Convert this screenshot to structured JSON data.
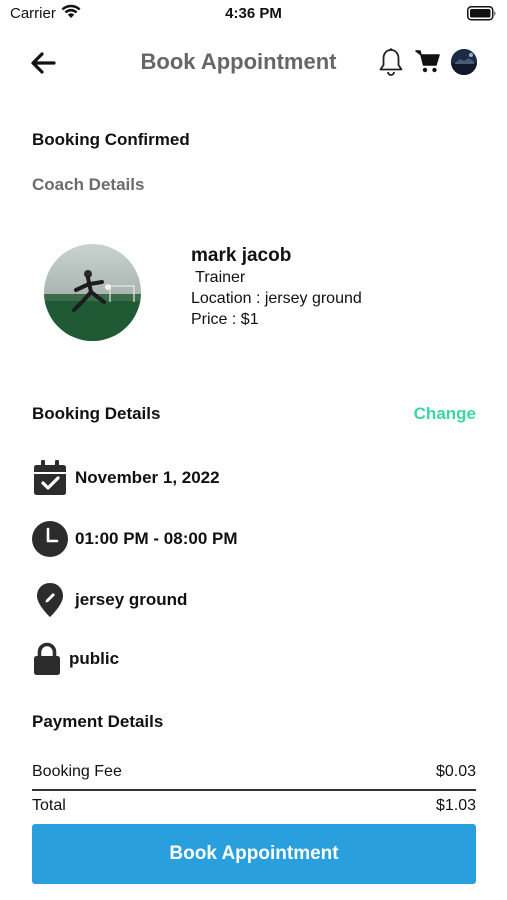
{
  "status_bar": {
    "carrier": "Carrier",
    "time": "4:36 PM"
  },
  "header": {
    "title": "Book Appointment",
    "icons": [
      "back-arrow-icon",
      "bell-icon",
      "cart-icon",
      "profile-avatar"
    ]
  },
  "booking": {
    "status": "Booking Confirmed"
  },
  "coach": {
    "section_title": "Coach Details",
    "name": "mark jacob",
    "role": " Trainer",
    "location": "Location : jersey ground",
    "price": "Price : $1"
  },
  "booking_details": {
    "title": "Booking Details",
    "change_label": "Change",
    "date": "November 1, 2022",
    "time": "01:00 PM - 08:00 PM",
    "venue": "jersey ground",
    "visibility": "public"
  },
  "payment": {
    "title": "Payment Details",
    "fee_label": "Booking Fee",
    "fee_value": "$0.03",
    "total_label": "Total",
    "total_value": "$1.03"
  },
  "cta": {
    "label": "Book Appointment"
  },
  "colors": {
    "accent_green": "#3dd6a3",
    "button_blue": "#2a9fdd",
    "heading_gray": "#666666"
  }
}
